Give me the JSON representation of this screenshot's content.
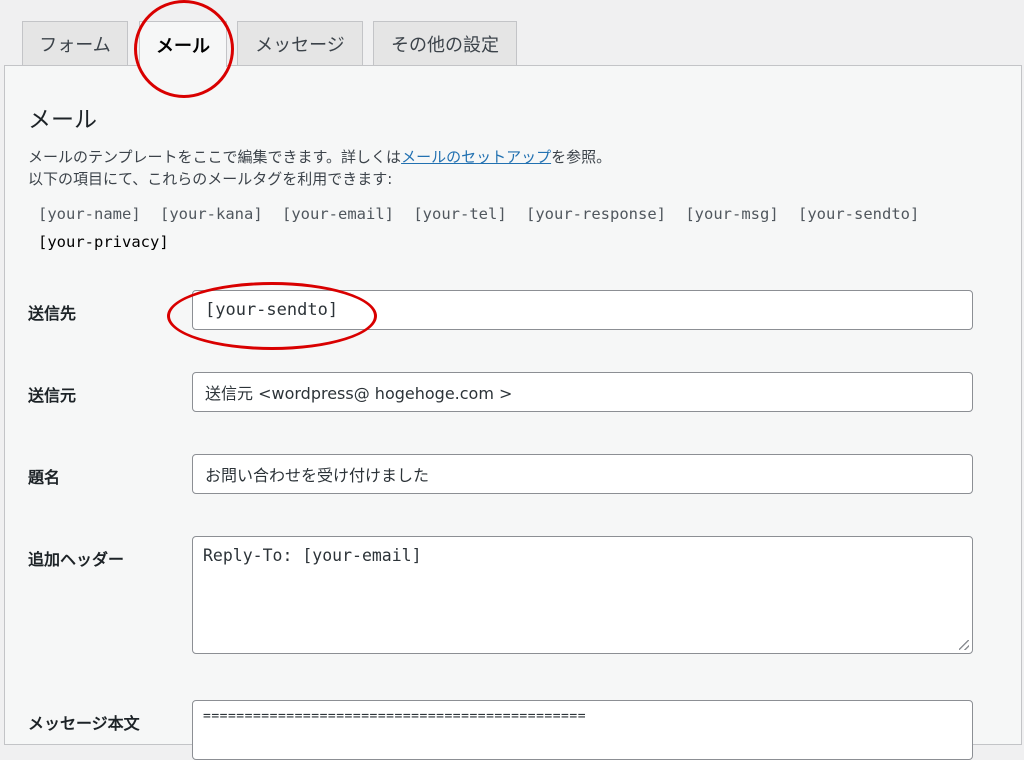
{
  "tabs": [
    {
      "label": "フォーム"
    },
    {
      "label": "メール"
    },
    {
      "label": "メッセージ"
    },
    {
      "label": "その他の設定"
    }
  ],
  "panel": {
    "title": "メール",
    "desc_line1_prefix": "メールのテンプレートをここで編集できます。詳しくは",
    "desc_link": "メールのセットアップ",
    "desc_line1_suffix": "を参照。",
    "desc_line2": "以下の項目にて、これらのメールタグを利用できます:",
    "tags": [
      "[your-name]",
      "[your-kana]",
      "[your-email]",
      "[your-tel]",
      "[your-response]",
      "[your-msg]",
      "[your-sendto]",
      "[your-privacy]"
    ]
  },
  "fields": {
    "to_label": "送信先",
    "to_value": "[your-sendto]",
    "from_label": "送信元",
    "from_value": "送信元 <wordpress@ hogehoge.com >",
    "subject_label": "題名",
    "subject_value": "お問い合わせを受け付けました",
    "headers_label": "追加ヘッダー",
    "headers_value": "Reply-To: [your-email]",
    "body_label": "メッセージ本文",
    "body_value": "=============================================="
  },
  "colors": {
    "accent_link": "#2271b1",
    "annotation_circle": "#d90000"
  }
}
